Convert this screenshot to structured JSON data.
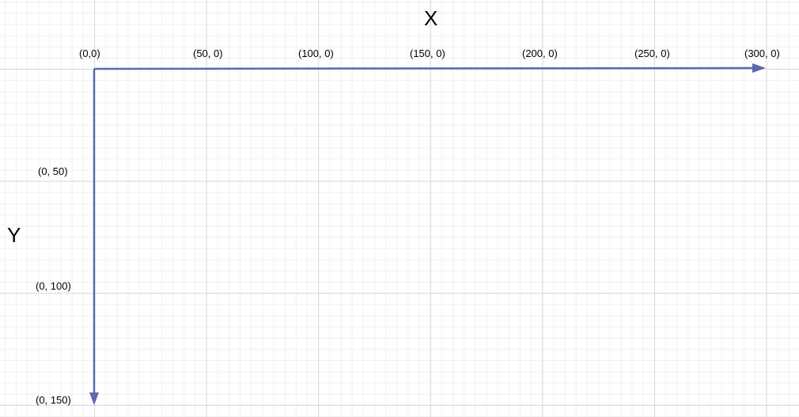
{
  "axis_titles": {
    "x": "X",
    "y": "Y"
  },
  "x_labels": [
    "(0,0)",
    "(50, 0)",
    "(100, 0)",
    "(150, 0)",
    "(200, 0)",
    "(250, 0)",
    "(300, 0)"
  ],
  "y_labels": [
    "(0, 50)",
    "(0, 100)",
    "(0, 150)"
  ],
  "colors": {
    "axis": "#5b6aad",
    "grid_major": "#d9d9d9",
    "grid_minor": "#f0f0f0",
    "background": "#ffffff"
  }
}
